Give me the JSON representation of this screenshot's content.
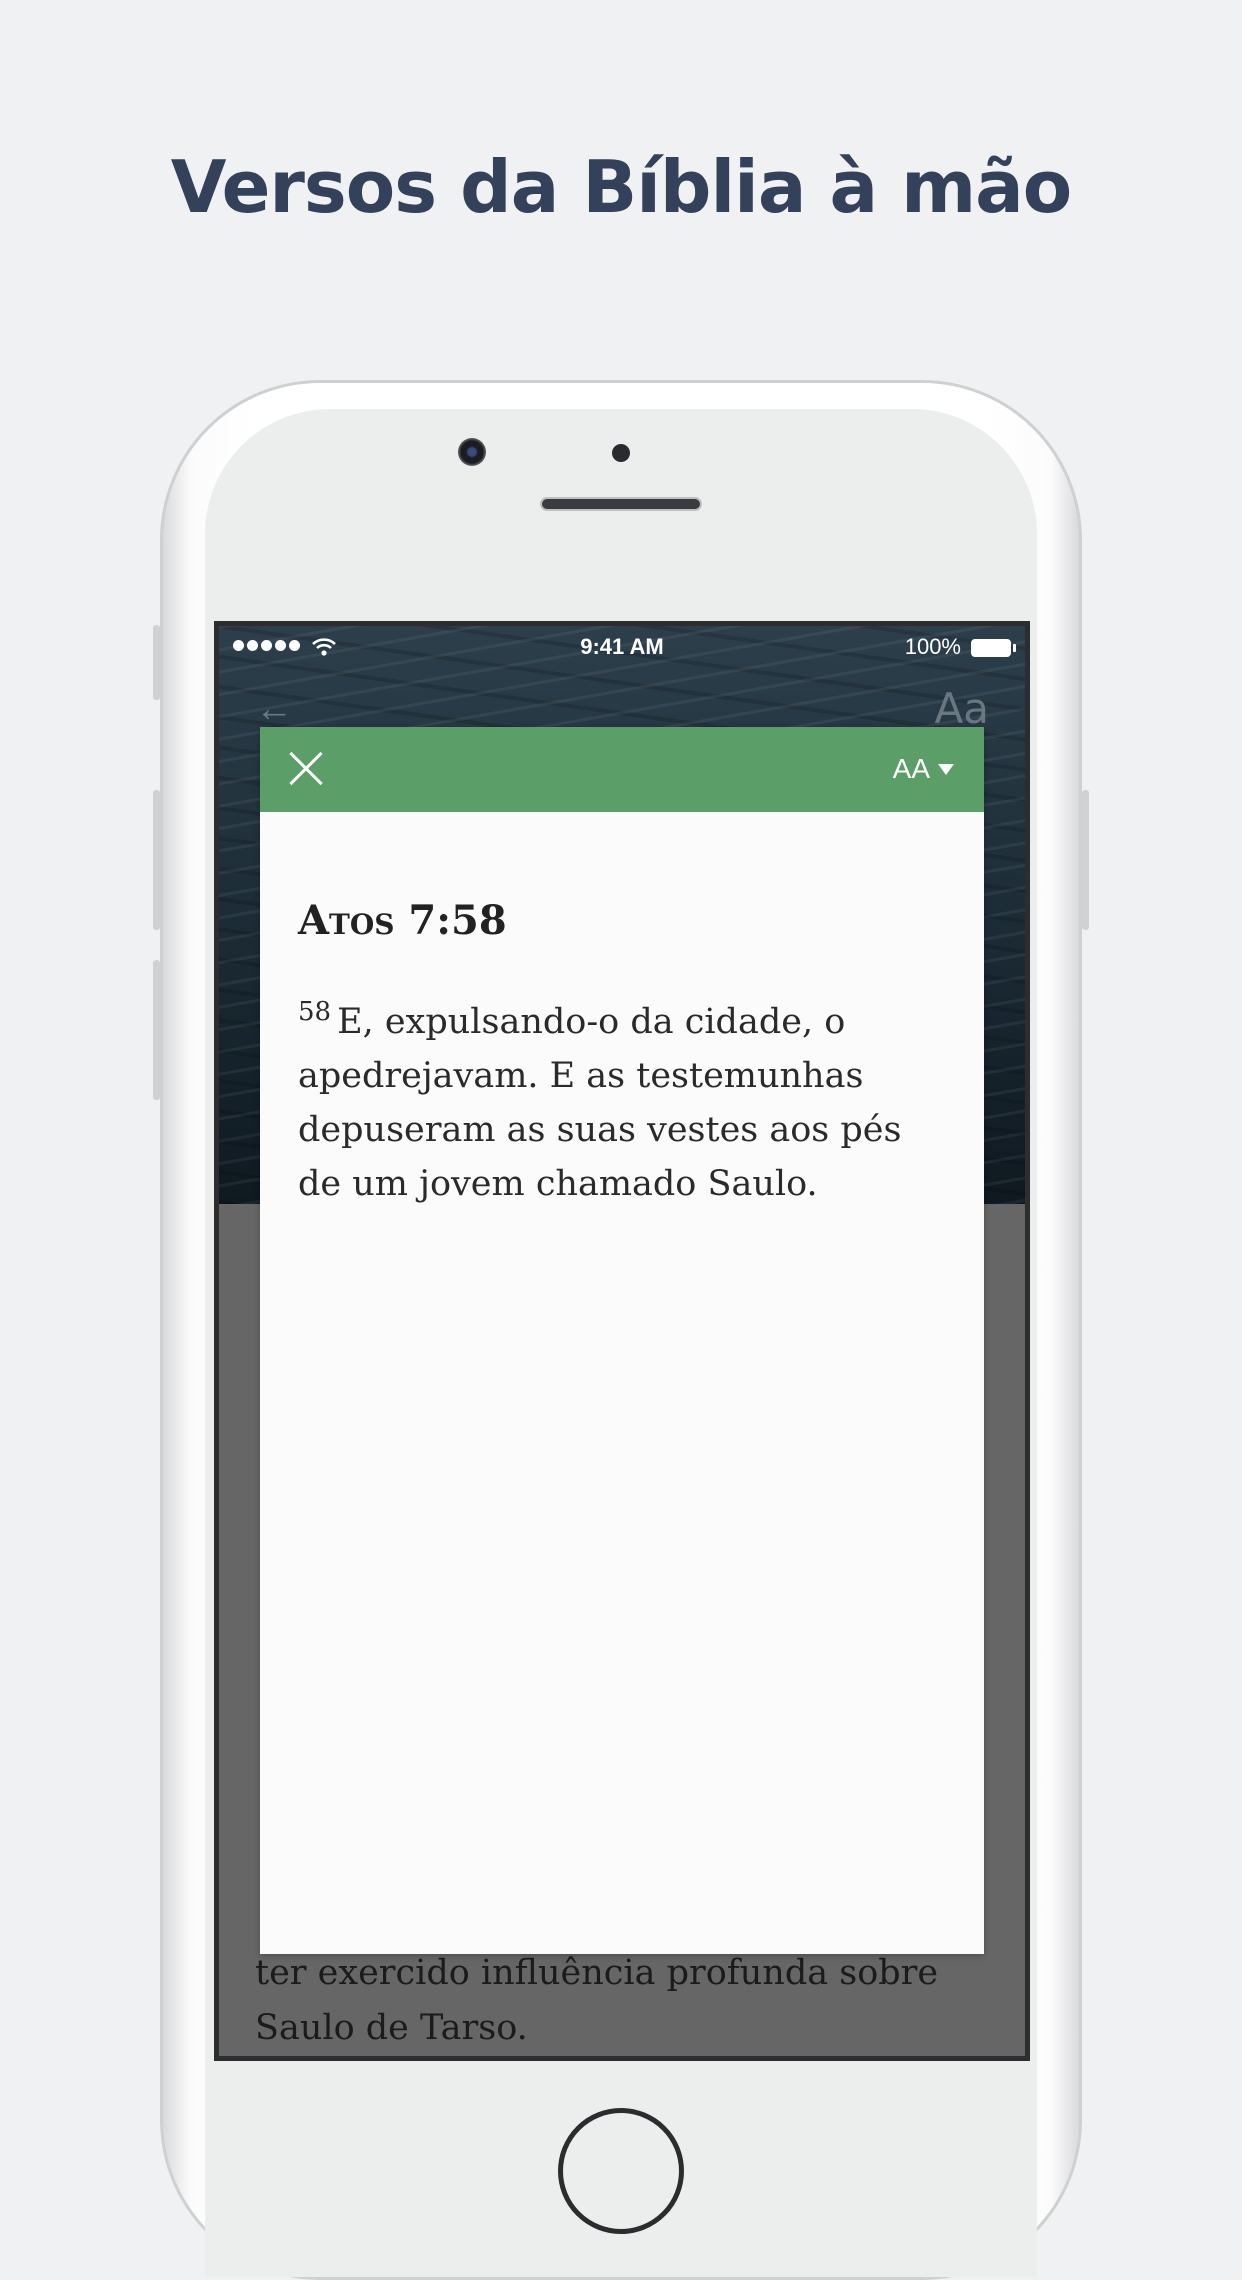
{
  "headline": "Versos da Bíblia à mão",
  "status_bar": {
    "time": "9:41 AM",
    "battery": "100%"
  },
  "app_bar": {
    "font_label": "Aa"
  },
  "popup": {
    "font_size_label": "AA",
    "reference": "Atos 7:58",
    "verse_number": "58",
    "verse_text": "E, expulsando-o da cidade, o apedrejavam. E as testemunhas depuseram as suas vestes aos pés de um jovem chamado Saulo."
  },
  "background_text": "ter exercido influência profunda sobre Saulo de Tarso.",
  "colors": {
    "header_green": "#5b9e67",
    "headline": "#33415a"
  }
}
